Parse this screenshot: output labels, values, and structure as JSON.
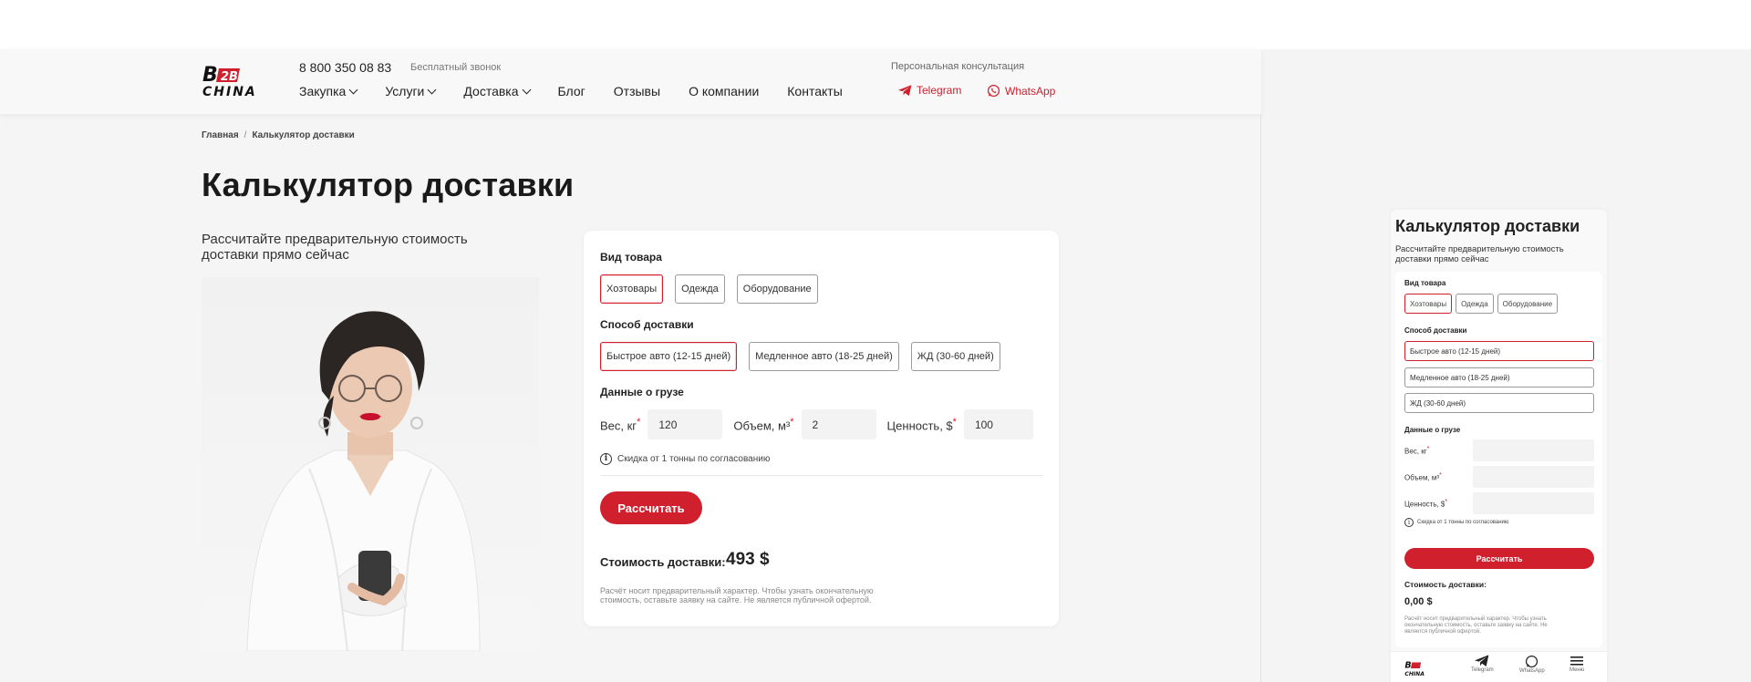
{
  "header": {
    "logo_top": "B2B",
    "logo_bottom": "CHINA",
    "phone": "8 800 350 08 83",
    "phone_note": "Бесплатный звонок",
    "consult": "Персональная консультация",
    "nav": [
      {
        "label": "Закупка",
        "dropdown": true
      },
      {
        "label": "Услуги",
        "dropdown": true
      },
      {
        "label": "Доставка",
        "dropdown": true
      },
      {
        "label": "Блог",
        "dropdown": false
      },
      {
        "label": "Отзывы",
        "dropdown": false
      },
      {
        "label": "О компании",
        "dropdown": false
      },
      {
        "label": "Контакты",
        "dropdown": false
      }
    ],
    "telegram": "Telegram",
    "whatsapp": "WhatsApp"
  },
  "breadcrumb": {
    "home": "Главная",
    "sep": "/",
    "current": "Калькулятор доставки"
  },
  "page": {
    "title": "Калькулятор доставки",
    "subtitle": "Рассчитайте предварительную стоимость доставки прямо сейчас"
  },
  "form": {
    "goods_label": "Вид товара",
    "goods": [
      "Хозтовары",
      "Одежда",
      "Оборудование"
    ],
    "goods_active": 0,
    "delivery_label": "Способ доставки",
    "delivery": [
      "Быстрое авто (12-15 дней)",
      "Медленное авто (18-25 дней)",
      "ЖД (30-60 дней)"
    ],
    "delivery_active": 0,
    "cargo_label": "Данные о грузе",
    "weight_label": "Вес, кг",
    "weight_value": "120",
    "volume_label": "Объем, м³",
    "volume_value": "2",
    "value_label": "Ценность, $",
    "value_value": "100",
    "required_mark": "*",
    "note": "Скидка от 1 тонны по согласованию",
    "button": "Рассчитать",
    "cost_label": "Стоимость доставки:",
    "cost_value": "493 $",
    "disclaimer": "Расчёт носит предварительный характер. Чтобы узнать окончательную стоимость, оставьте заявку на сайте. Не является публичной офертой."
  },
  "mobile": {
    "cost_value": "0,00 $",
    "tabs": [
      "Telegram",
      "WhatsApp",
      "Меню"
    ]
  },
  "colors": {
    "accent": "#d0202e",
    "text": "#1a1a1a",
    "background": "#f5f5f5"
  }
}
